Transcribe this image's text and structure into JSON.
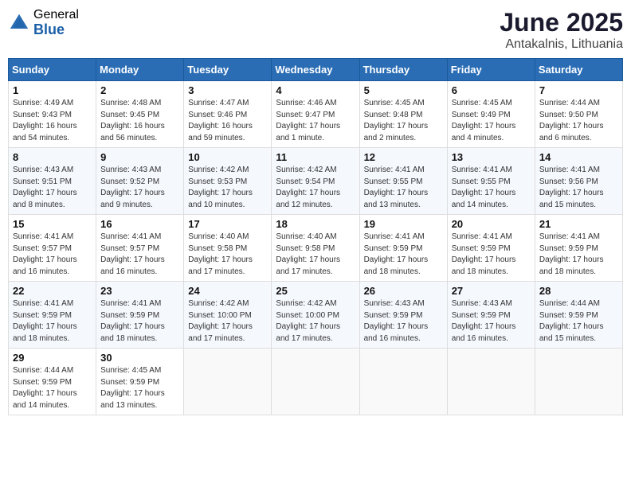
{
  "header": {
    "logo_general": "General",
    "logo_blue": "Blue",
    "month_year": "June 2025",
    "location": "Antakalnis, Lithuania"
  },
  "days_of_week": [
    "Sunday",
    "Monday",
    "Tuesday",
    "Wednesday",
    "Thursday",
    "Friday",
    "Saturday"
  ],
  "weeks": [
    [
      {
        "day": "1",
        "sunrise": "Sunrise: 4:49 AM",
        "sunset": "Sunset: 9:43 PM",
        "daylight": "Daylight: 16 hours and 54 minutes."
      },
      {
        "day": "2",
        "sunrise": "Sunrise: 4:48 AM",
        "sunset": "Sunset: 9:45 PM",
        "daylight": "Daylight: 16 hours and 56 minutes."
      },
      {
        "day": "3",
        "sunrise": "Sunrise: 4:47 AM",
        "sunset": "Sunset: 9:46 PM",
        "daylight": "Daylight: 16 hours and 59 minutes."
      },
      {
        "day": "4",
        "sunrise": "Sunrise: 4:46 AM",
        "sunset": "Sunset: 9:47 PM",
        "daylight": "Daylight: 17 hours and 1 minute."
      },
      {
        "day": "5",
        "sunrise": "Sunrise: 4:45 AM",
        "sunset": "Sunset: 9:48 PM",
        "daylight": "Daylight: 17 hours and 2 minutes."
      },
      {
        "day": "6",
        "sunrise": "Sunrise: 4:45 AM",
        "sunset": "Sunset: 9:49 PM",
        "daylight": "Daylight: 17 hours and 4 minutes."
      },
      {
        "day": "7",
        "sunrise": "Sunrise: 4:44 AM",
        "sunset": "Sunset: 9:50 PM",
        "daylight": "Daylight: 17 hours and 6 minutes."
      }
    ],
    [
      {
        "day": "8",
        "sunrise": "Sunrise: 4:43 AM",
        "sunset": "Sunset: 9:51 PM",
        "daylight": "Daylight: 17 hours and 8 minutes."
      },
      {
        "day": "9",
        "sunrise": "Sunrise: 4:43 AM",
        "sunset": "Sunset: 9:52 PM",
        "daylight": "Daylight: 17 hours and 9 minutes."
      },
      {
        "day": "10",
        "sunrise": "Sunrise: 4:42 AM",
        "sunset": "Sunset: 9:53 PM",
        "daylight": "Daylight: 17 hours and 10 minutes."
      },
      {
        "day": "11",
        "sunrise": "Sunrise: 4:42 AM",
        "sunset": "Sunset: 9:54 PM",
        "daylight": "Daylight: 17 hours and 12 minutes."
      },
      {
        "day": "12",
        "sunrise": "Sunrise: 4:41 AM",
        "sunset": "Sunset: 9:55 PM",
        "daylight": "Daylight: 17 hours and 13 minutes."
      },
      {
        "day": "13",
        "sunrise": "Sunrise: 4:41 AM",
        "sunset": "Sunset: 9:55 PM",
        "daylight": "Daylight: 17 hours and 14 minutes."
      },
      {
        "day": "14",
        "sunrise": "Sunrise: 4:41 AM",
        "sunset": "Sunset: 9:56 PM",
        "daylight": "Daylight: 17 hours and 15 minutes."
      }
    ],
    [
      {
        "day": "15",
        "sunrise": "Sunrise: 4:41 AM",
        "sunset": "Sunset: 9:57 PM",
        "daylight": "Daylight: 17 hours and 16 minutes."
      },
      {
        "day": "16",
        "sunrise": "Sunrise: 4:41 AM",
        "sunset": "Sunset: 9:57 PM",
        "daylight": "Daylight: 17 hours and 16 minutes."
      },
      {
        "day": "17",
        "sunrise": "Sunrise: 4:40 AM",
        "sunset": "Sunset: 9:58 PM",
        "daylight": "Daylight: 17 hours and 17 minutes."
      },
      {
        "day": "18",
        "sunrise": "Sunrise: 4:40 AM",
        "sunset": "Sunset: 9:58 PM",
        "daylight": "Daylight: 17 hours and 17 minutes."
      },
      {
        "day": "19",
        "sunrise": "Sunrise: 4:41 AM",
        "sunset": "Sunset: 9:59 PM",
        "daylight": "Daylight: 17 hours and 18 minutes."
      },
      {
        "day": "20",
        "sunrise": "Sunrise: 4:41 AM",
        "sunset": "Sunset: 9:59 PM",
        "daylight": "Daylight: 17 hours and 18 minutes."
      },
      {
        "day": "21",
        "sunrise": "Sunrise: 4:41 AM",
        "sunset": "Sunset: 9:59 PM",
        "daylight": "Daylight: 17 hours and 18 minutes."
      }
    ],
    [
      {
        "day": "22",
        "sunrise": "Sunrise: 4:41 AM",
        "sunset": "Sunset: 9:59 PM",
        "daylight": "Daylight: 17 hours and 18 minutes."
      },
      {
        "day": "23",
        "sunrise": "Sunrise: 4:41 AM",
        "sunset": "Sunset: 9:59 PM",
        "daylight": "Daylight: 17 hours and 18 minutes."
      },
      {
        "day": "24",
        "sunrise": "Sunrise: 4:42 AM",
        "sunset": "Sunset: 10:00 PM",
        "daylight": "Daylight: 17 hours and 17 minutes."
      },
      {
        "day": "25",
        "sunrise": "Sunrise: 4:42 AM",
        "sunset": "Sunset: 10:00 PM",
        "daylight": "Daylight: 17 hours and 17 minutes."
      },
      {
        "day": "26",
        "sunrise": "Sunrise: 4:43 AM",
        "sunset": "Sunset: 9:59 PM",
        "daylight": "Daylight: 17 hours and 16 minutes."
      },
      {
        "day": "27",
        "sunrise": "Sunrise: 4:43 AM",
        "sunset": "Sunset: 9:59 PM",
        "daylight": "Daylight: 17 hours and 16 minutes."
      },
      {
        "day": "28",
        "sunrise": "Sunrise: 4:44 AM",
        "sunset": "Sunset: 9:59 PM",
        "daylight": "Daylight: 17 hours and 15 minutes."
      }
    ],
    [
      {
        "day": "29",
        "sunrise": "Sunrise: 4:44 AM",
        "sunset": "Sunset: 9:59 PM",
        "daylight": "Daylight: 17 hours and 14 minutes."
      },
      {
        "day": "30",
        "sunrise": "Sunrise: 4:45 AM",
        "sunset": "Sunset: 9:59 PM",
        "daylight": "Daylight: 17 hours and 13 minutes."
      },
      null,
      null,
      null,
      null,
      null
    ]
  ]
}
